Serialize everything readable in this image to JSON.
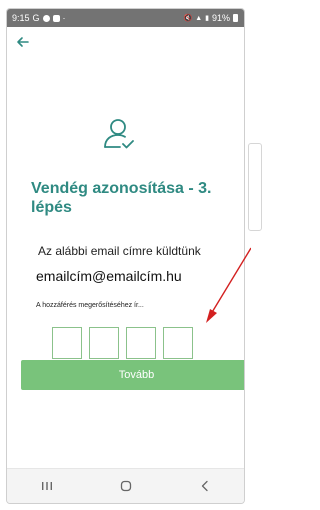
{
  "statusbar": {
    "time": "9:15",
    "carrier": "G",
    "battery_text": "91%"
  },
  "nav": {
    "back_icon": "back-arrow-icon"
  },
  "header": {
    "icon": "user-check-icon",
    "title": "Vendég azonosítása - 3. lépés"
  },
  "body": {
    "subtitle": "Az alábbi email címre küldtünk",
    "email": "emailcím@emailcím.hu",
    "hint": "A hozzáférés megerősítéséhez ír..."
  },
  "code": {
    "boxes": [
      "",
      "",
      "",
      ""
    ]
  },
  "actions": {
    "continue_label": "Tovább"
  },
  "colors": {
    "accent": "#2f8a82",
    "button": "#79c37b",
    "code_border": "#8bc28b",
    "annotation_arrow": "#d32020"
  }
}
